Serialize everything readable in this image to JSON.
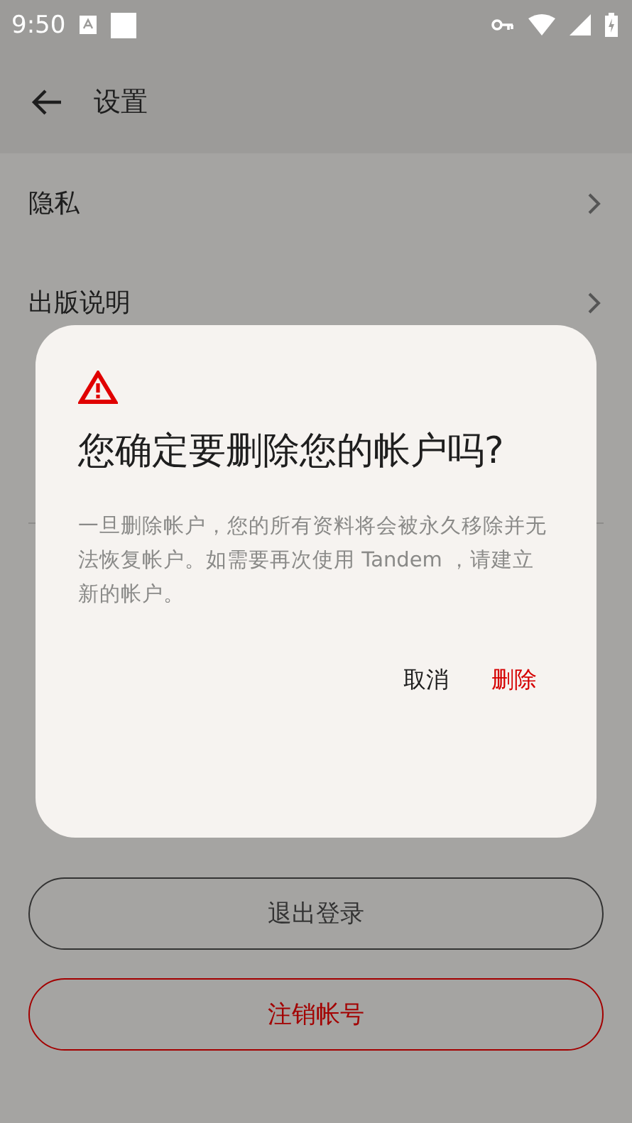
{
  "status_bar": {
    "time": "9:50"
  },
  "app_bar": {
    "title": "设置"
  },
  "settings_items": [
    {
      "label": "隐私"
    },
    {
      "label": "出版说明"
    }
  ],
  "buttons": [
    {
      "label": "退出登录",
      "kind": "neutral"
    },
    {
      "label": "注销帐号",
      "kind": "danger"
    }
  ],
  "dialog": {
    "title": "您确定要删除您的帐户吗?",
    "message": "一旦删除帐户，您的所有资料将会被永久移除并无法恢复帐户。如需要再次使用 Tandem ，请建立新的帐户。",
    "actions": [
      {
        "label": "取消",
        "kind": "cancel"
      },
      {
        "label": "删除",
        "kind": "destructive"
      }
    ]
  }
}
